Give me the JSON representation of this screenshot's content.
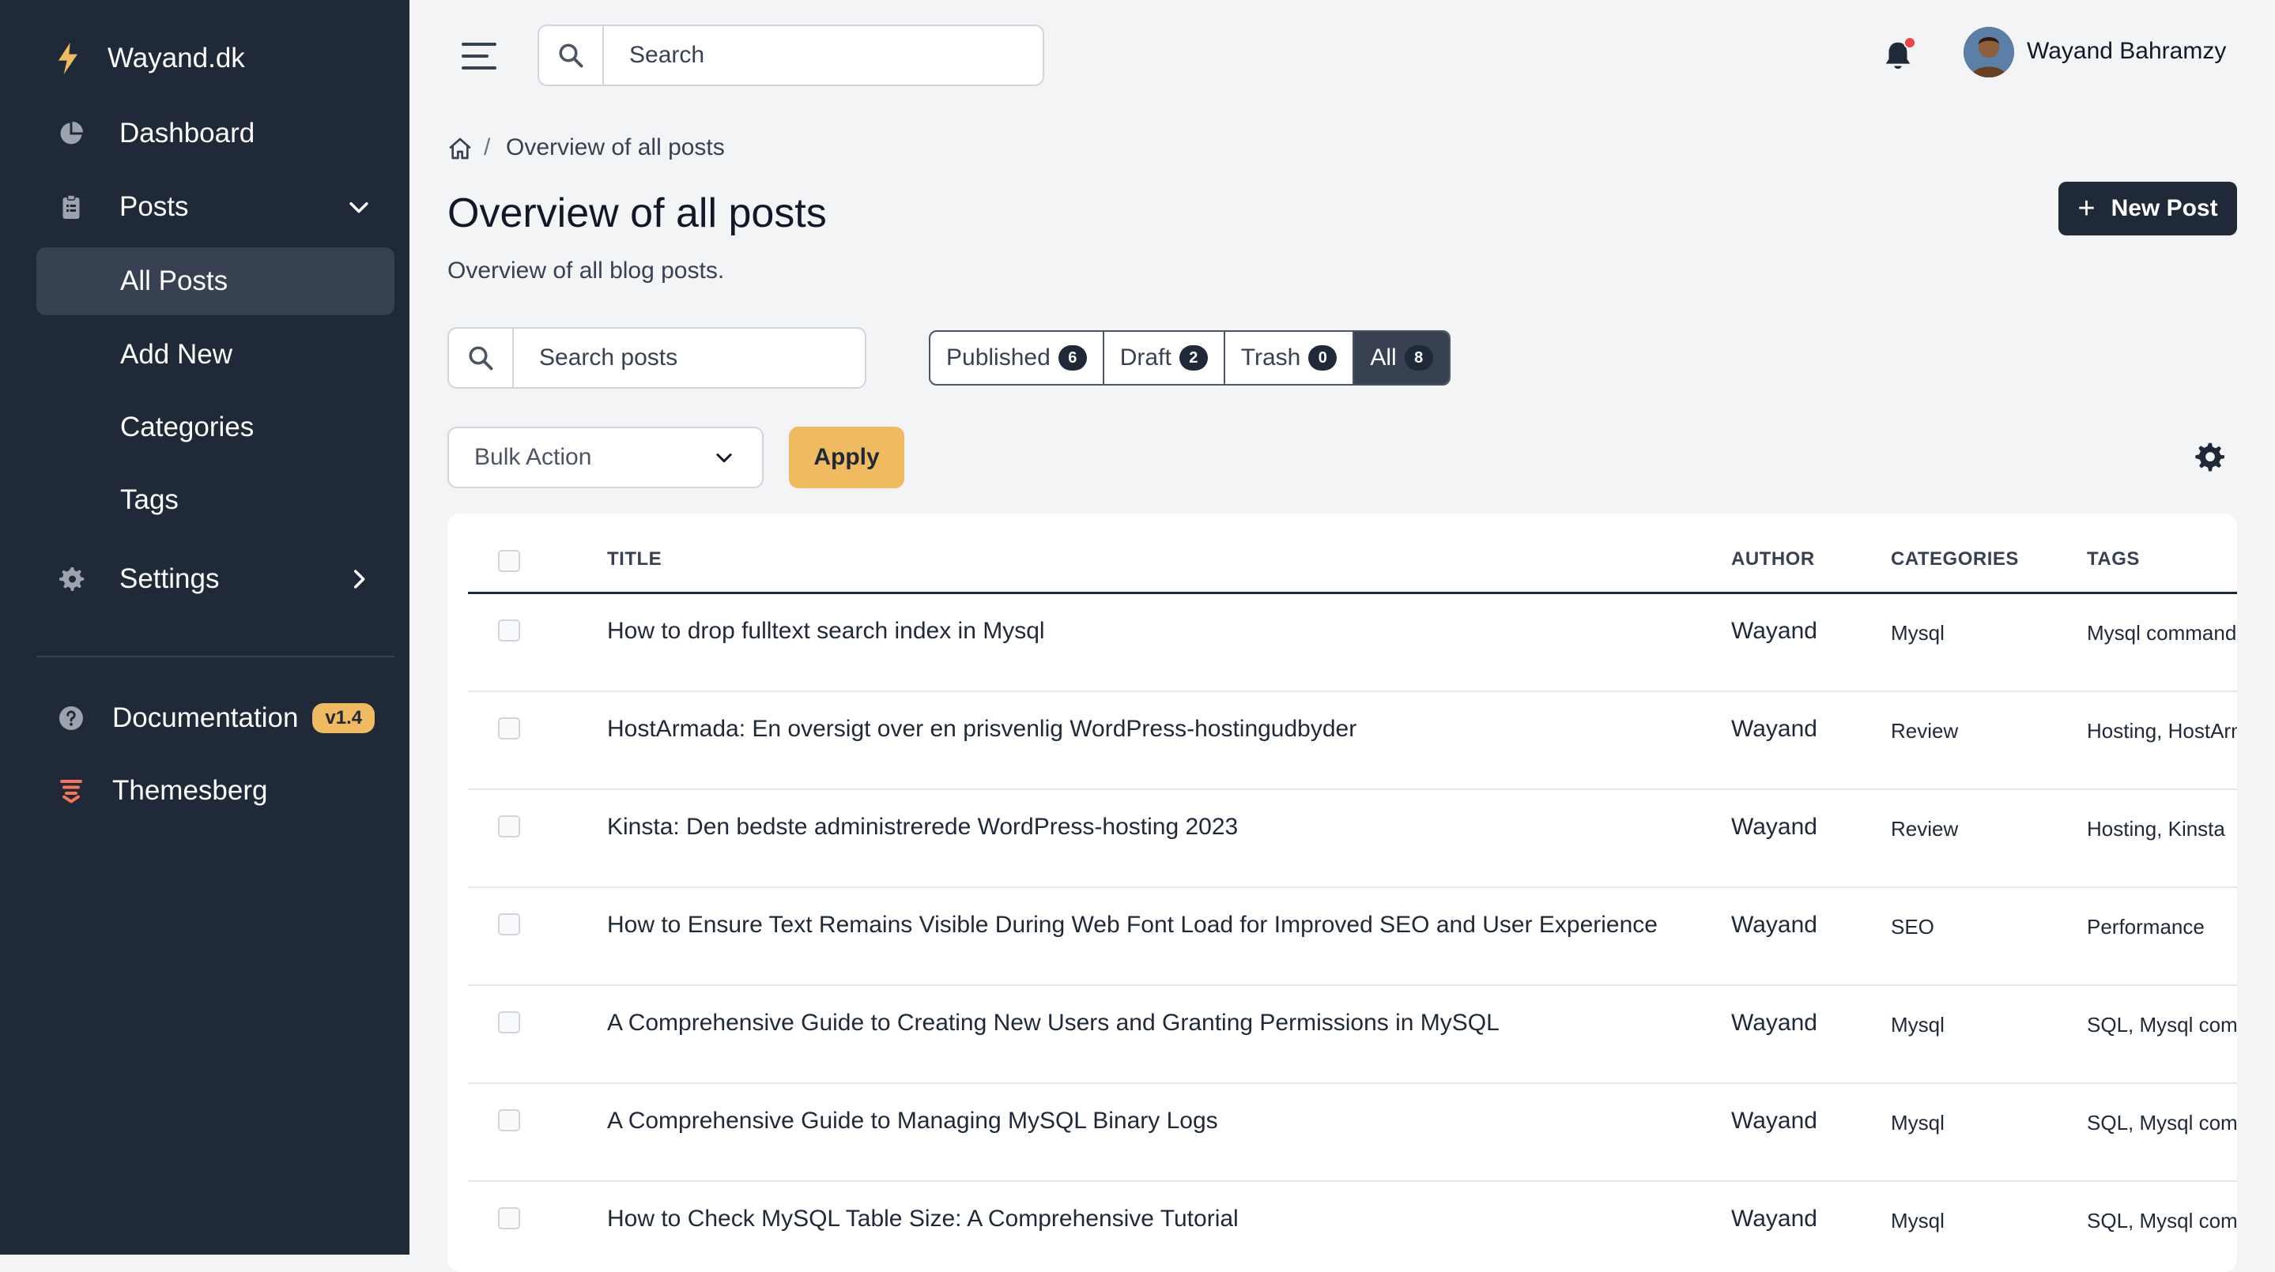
{
  "brand": {
    "name": "Wayand.dk"
  },
  "sidebar": {
    "items": [
      {
        "label": "Dashboard"
      },
      {
        "label": "Posts"
      },
      {
        "label": "All Posts"
      },
      {
        "label": "Add New"
      },
      {
        "label": "Categories"
      },
      {
        "label": "Tags"
      },
      {
        "label": "Settings"
      }
    ],
    "bottom": [
      {
        "label": "Documentation",
        "badge": "v1.4"
      },
      {
        "label": "Themesberg"
      }
    ]
  },
  "topbar": {
    "search_placeholder": "Search",
    "user_name": "Wayand Bahramzy"
  },
  "breadcrumb": {
    "separator": "/",
    "current": "Overview of all posts"
  },
  "page": {
    "title": "Overview of all posts",
    "subtitle": "Overview of all blog posts.",
    "new_post_label": "New Post",
    "new_post_plus": "+"
  },
  "filters": {
    "search_placeholder": "Search posts",
    "statuses": [
      {
        "label": "Published",
        "count": "6"
      },
      {
        "label": "Draft",
        "count": "2"
      },
      {
        "label": "Trash",
        "count": "0"
      },
      {
        "label": "All",
        "count": "8"
      }
    ],
    "bulk_action": "Bulk Action",
    "apply_label": "Apply"
  },
  "table": {
    "headers": {
      "title": "TITLE",
      "author": "AUTHOR",
      "categories": "CATEGORIES",
      "tags": "TAGS"
    },
    "rows": [
      {
        "title": "How to drop fulltext search index in Mysql",
        "author": "Wayand",
        "category": "Mysql",
        "tags": "Mysql command"
      },
      {
        "title": "HostArmada: En oversigt over en prisvenlig WordPress-hostingudbyder",
        "author": "Wayand",
        "category": "Review",
        "tags": "Hosting, HostArmada"
      },
      {
        "title": "Kinsta: Den bedste administrerede WordPress-hosting 2023",
        "author": "Wayand",
        "category": "Review",
        "tags": "Hosting, Kinsta"
      },
      {
        "title": "How to Ensure Text Remains Visible During Web Font Load for Improved SEO and User Experience",
        "author": "Wayand",
        "category": "SEO",
        "tags": "Performance"
      },
      {
        "title": "A Comprehensive Guide to Creating New Users and Granting Permissions in MySQL",
        "author": "Wayand",
        "category": "Mysql",
        "tags": "SQL, Mysql command"
      },
      {
        "title": "A Comprehensive Guide to Managing MySQL Binary Logs",
        "author": "Wayand",
        "category": "Mysql",
        "tags": "SQL, Mysql command"
      },
      {
        "title": "How to Check MySQL Table Size: A Comprehensive Tutorial",
        "author": "Wayand",
        "category": "Mysql",
        "tags": "SQL, Mysql command"
      }
    ]
  },
  "colors": {
    "sidebar_bg": "#1f2937",
    "accent": "#f0ba61",
    "brand_bolt": "#f0ba61",
    "notification": "#ef4444"
  },
  "icons": [
    "bolt-icon",
    "pie-chart-icon",
    "clipboard-icon",
    "chevron-down-icon",
    "gear-icon",
    "chevron-right-icon",
    "question-circle-icon",
    "themesberg-logo-icon",
    "hamburger-icon",
    "search-icon",
    "bell-icon",
    "home-icon",
    "plus-icon"
  ]
}
